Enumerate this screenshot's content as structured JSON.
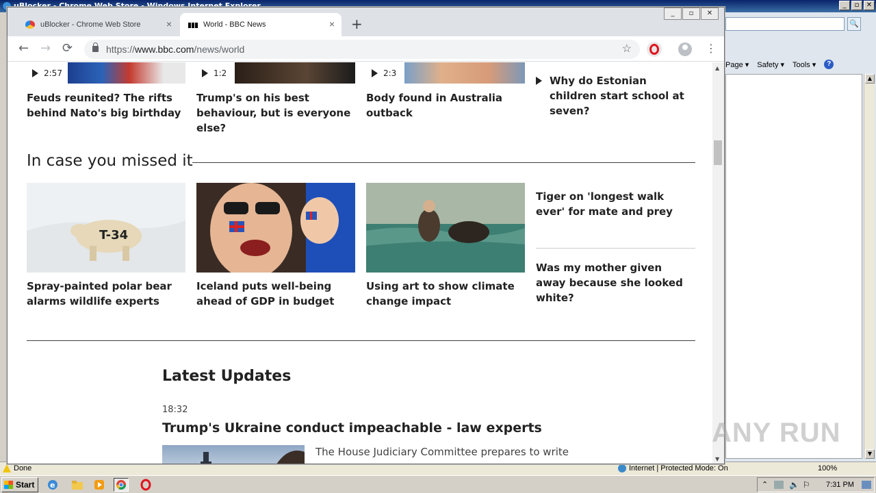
{
  "ie": {
    "title": "uBlocker - Chrome Web Store - Windows Internet Explorer",
    "cmd_page": "Page ▾",
    "cmd_safety": "Safety ▾",
    "cmd_tools": "Tools ▾",
    "cmd_help": "?",
    "status_done": "Done",
    "status_zone": "Internet | Protected Mode: On",
    "status_zoom": "100%",
    "search_glyph": "🔍"
  },
  "chrome": {
    "tabs": [
      {
        "label": "uBlocker - Chrome Web Store",
        "close": "×"
      },
      {
        "label": "World - BBC News",
        "close": "×"
      }
    ],
    "newtab": "+",
    "url_scheme": "https://",
    "url_host": "www.bbc.com",
    "url_path": "/news/world",
    "back": "←",
    "forward": "→",
    "reload": "⟳",
    "star": "☆",
    "menu": "⋮"
  },
  "bbc": {
    "top_row": [
      {
        "duration": "2:57",
        "headline": "Feuds reunited? The rifts behind Nato's big birthday"
      },
      {
        "duration": "1:2",
        "headline": "Trump's on his best behaviour, but is everyone else?"
      },
      {
        "duration": "2:3",
        "headline": "Body found in Australia outback"
      }
    ],
    "top_side": "Why do Estonian children start school at seven?",
    "section_title": "In case you missed it",
    "missed": [
      {
        "headline": "Spray-painted polar bear alarms wildlife experts"
      },
      {
        "headline": "Iceland puts well-being ahead of GDP in budget"
      },
      {
        "headline": "Using art to show climate change impact"
      }
    ],
    "side_links": [
      "Tiger on 'longest walk ever' for mate and prey",
      "Was my mother given away because she looked white?"
    ],
    "latest_title": "Latest Updates",
    "update_time": "18:32",
    "update_headline": "Trump's Ukraine conduct impeachable - law experts",
    "update_summary": "The House Judiciary Committee prepares to write"
  },
  "taskbar": {
    "start": "Start",
    "clock": "7:31 PM"
  },
  "watermark": "ANY RUN"
}
